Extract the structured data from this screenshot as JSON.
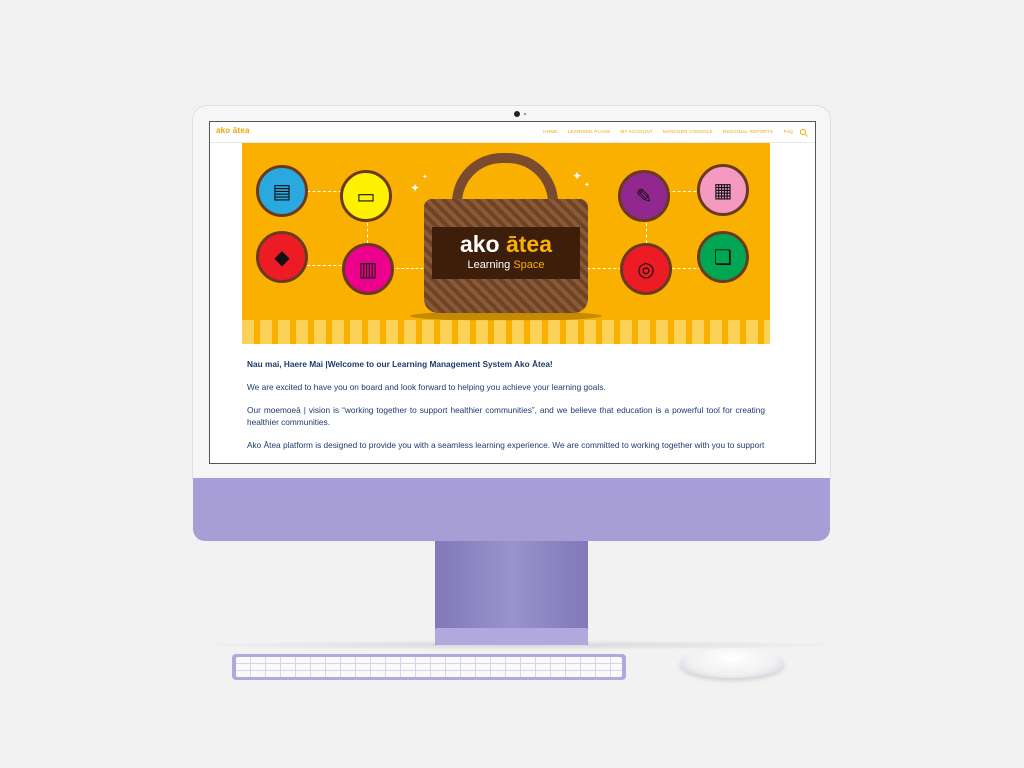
{
  "app": {
    "logo_text": "ako ātea"
  },
  "nav": {
    "items": [
      {
        "label": "HOME"
      },
      {
        "label": "LEARNING PLANS"
      },
      {
        "label": "MY ACCOUNT"
      },
      {
        "label": "MANAGER CONSOLE"
      },
      {
        "label": "REGIONAL REPORTS"
      }
    ],
    "faq_label": "FAQ",
    "search_icon": "search-icon"
  },
  "banner": {
    "title_main": "ako",
    "title_accent": "ātea",
    "subtitle_main": "Learning",
    "subtitle_accent": "Space",
    "icons": [
      {
        "name": "certificate-search-icon",
        "color": "#29a9e0"
      },
      {
        "name": "computer-cursor-icon",
        "color": "#fff200"
      },
      {
        "name": "graduation-cap-icon",
        "color": "#ed1c24"
      },
      {
        "name": "books-icon",
        "color": "#ec008c"
      },
      {
        "name": "pencil-ruler-icon",
        "color": "#92278f"
      },
      {
        "name": "presentation-board-icon",
        "color": "#f49ac1"
      },
      {
        "name": "web-search-icon",
        "color": "#ed1c24"
      },
      {
        "name": "open-book-idea-icon",
        "color": "#00a651"
      }
    ]
  },
  "content": {
    "heading": "Nau mai, Haere Mai |Welcome to our Learning Management System Ako Ātea!",
    "p1": "We are excited to have you on board and look forward to helping you achieve your learning goals.",
    "p2": "Our moemoeā | vision is “working together to support healthier communities”, and we believe that education is a powerful tool for creating healthier communities.",
    "p3": "Ako Ātea platform is designed to provide you with a seamless learning experience. We are committed to working together with you to support"
  },
  "colors": {
    "accent": "#f0a500",
    "banner_bg": "#f9b000",
    "text": "#1e3a6e",
    "device_purple": "#a79ed9"
  }
}
